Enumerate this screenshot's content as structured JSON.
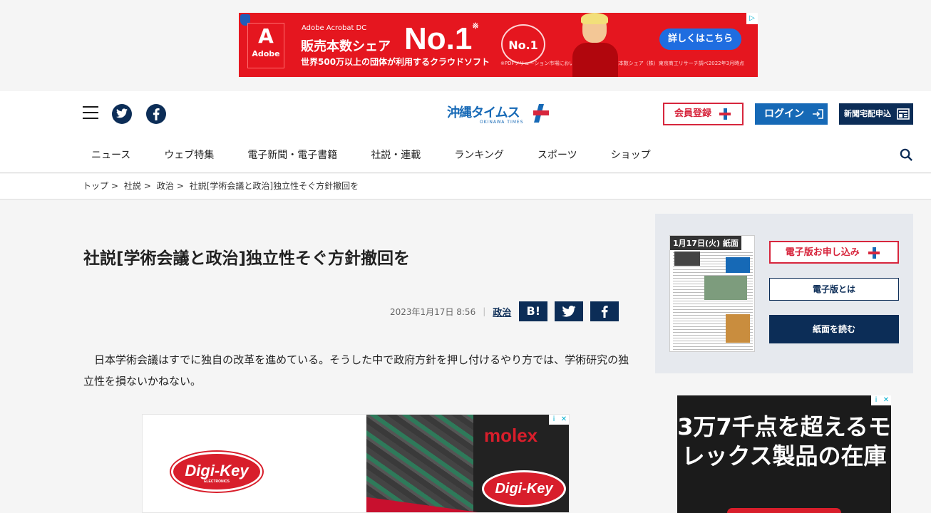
{
  "top_ad": {
    "adobe_label": "Adobe",
    "product": "Adobe Acrobat DC",
    "headline": "販売本数シェア",
    "no1": "No.1",
    "no1_mark": "※",
    "subline": "世界500万以上の団体が利用するクラウドソフト",
    "badge": "No.1",
    "cta": "詳しくはこちら",
    "fine_print": "※PDFソリューション市場において、直近年度の販売本数シェア（株）東京商工リサーチ調べ2022年3月時点"
  },
  "header": {
    "logo_jp": "沖縄タイムス",
    "logo_en": "OKINAWA TIMES",
    "register_label": "会員登録",
    "login_label": "ログイン",
    "delivery_label": "新聞宅配申込"
  },
  "nav": {
    "items": [
      "ニュース",
      "ウェブ特集",
      "電子新聞・電子書籍",
      "社説・連載",
      "ランキング",
      "スポーツ",
      "ショップ"
    ]
  },
  "breadcrumb": {
    "items": [
      "トップ",
      "社説",
      "政治",
      "社説[学術会議と政治]独立性そぐ方針撤回を"
    ],
    "separator": ">"
  },
  "article": {
    "title": "社説[学術会議と政治]独立性そぐ方針撤回を",
    "date": "2023年1月17日 8:56",
    "category": "政治",
    "hatena_label": "B!",
    "lead": "日本学術会議はすでに独自の改革を進めている。そうした中で政府方針を押し付けるやり方では、学術研究の独立性を損ないかねない。"
  },
  "mid_ad": {
    "brand_left": "Digi-Key",
    "brand_left_sub": "ELECTRONICS",
    "brand_right": "molex",
    "brand_right2": "Digi-Key"
  },
  "sidebar": {
    "paper_label": "1月17日(火) 紙面",
    "apply_label": "電子版お申し込み",
    "about_label": "電子版とは",
    "read_label": "紙面を読む"
  },
  "side_ad": {
    "text": "3万7千点を超えるモレックス製品の在庫"
  },
  "colors": {
    "navy": "#0c2d57",
    "blue": "#1669b6",
    "red": "#d7263d",
    "ad_red": "#e5161f"
  }
}
